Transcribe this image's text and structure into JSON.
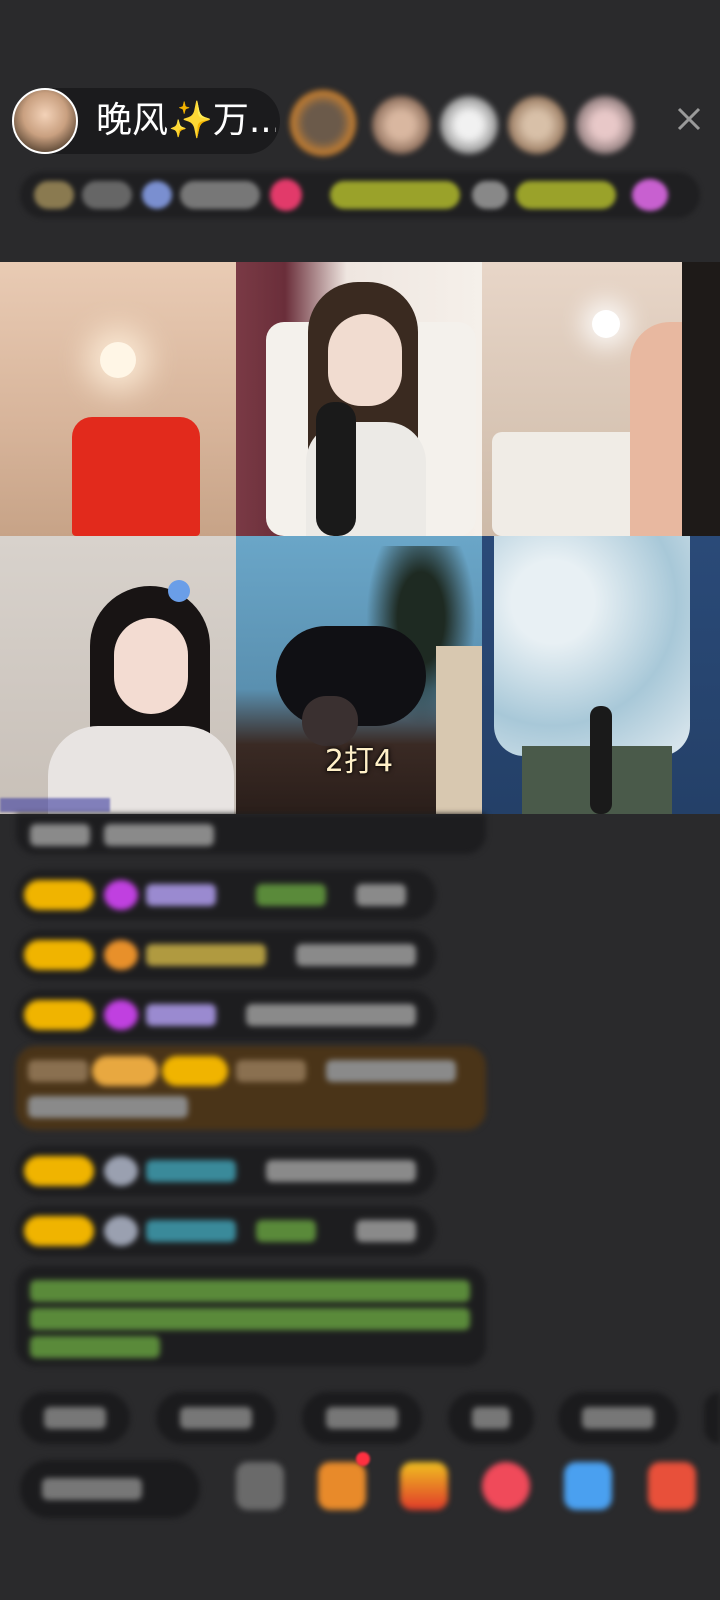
{
  "host": {
    "name": "晚风✨万..."
  },
  "video_tiles": [
    {
      "label": ""
    },
    {
      "label": ""
    },
    {
      "label": ""
    },
    {
      "label": ""
    },
    {
      "label": "2打4"
    },
    {
      "label": ""
    }
  ],
  "icons": {
    "close": "close-icon"
  },
  "colors": {
    "background": "#2a2a2c",
    "badge_gold": "#f0b400",
    "highlight_row": "#4a3418",
    "green_text": "#7fbf3a"
  }
}
